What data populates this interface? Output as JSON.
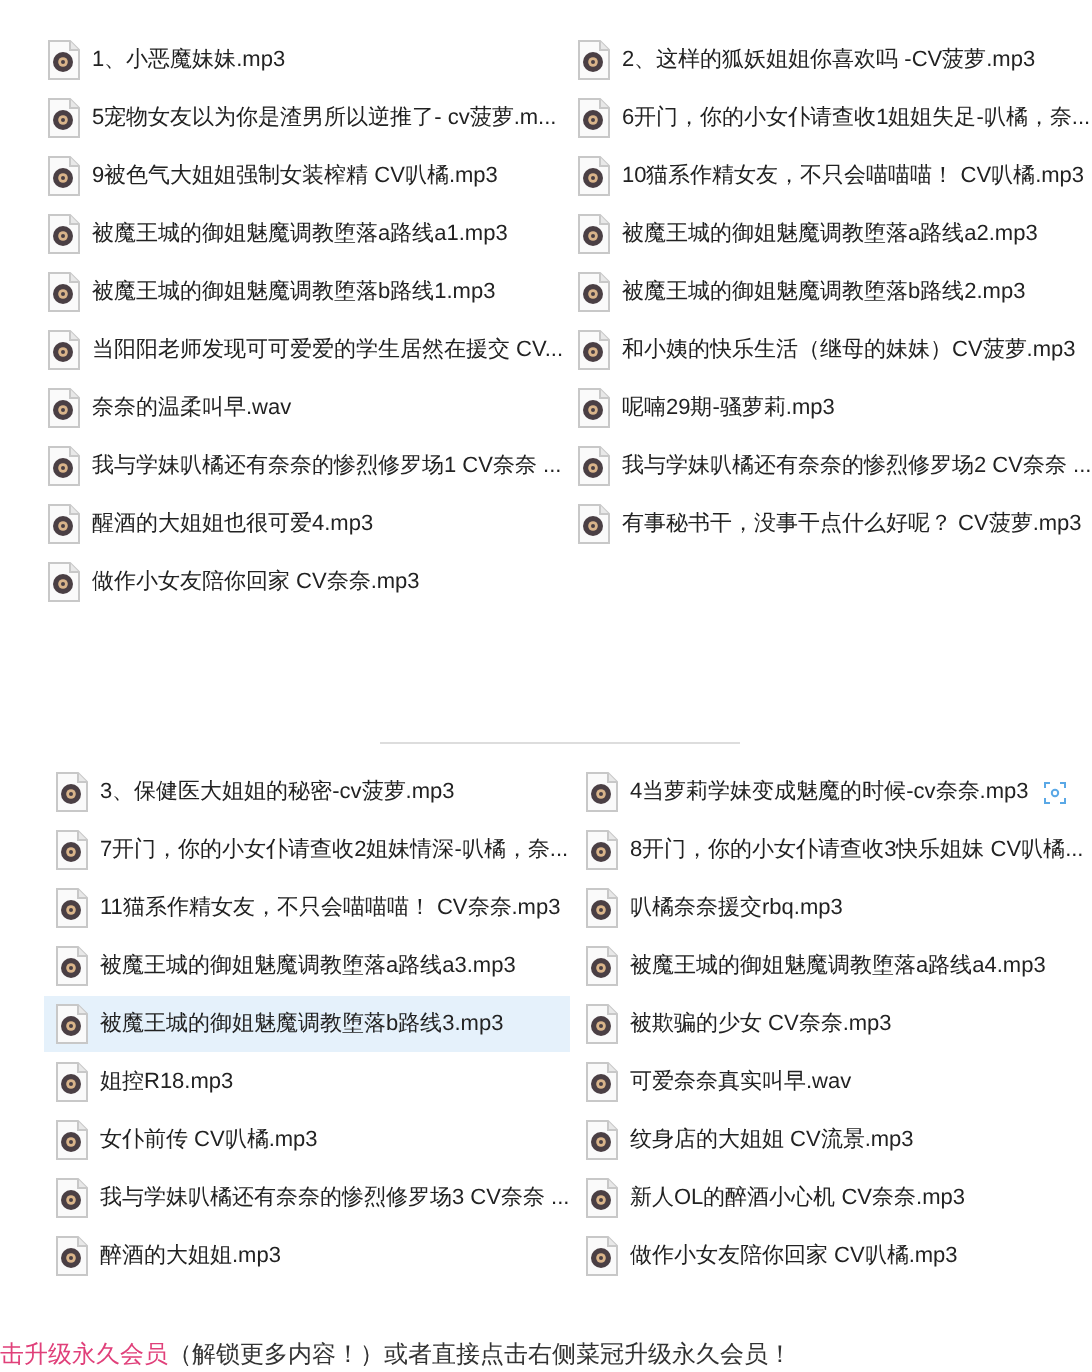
{
  "groups": [
    {
      "files": [
        {
          "name": "1、小恶魔妹妹.mp3",
          "selected": false
        },
        {
          "name": "2、这样的狐妖姐姐你喜欢吗 -CV菠萝.mp3",
          "selected": false
        },
        {
          "name": "5宠物女友以为你是渣男所以逆推了- cv菠萝.m...",
          "selected": false
        },
        {
          "name": "6开门，你的小女仆请查收1姐姐失足-叭橘，奈...",
          "selected": false
        },
        {
          "name": "9被色气大姐姐强制女装榨精 CV叭橘.mp3",
          "selected": false
        },
        {
          "name": "10猫系作精女友，不只会喵喵喵！ CV叭橘.mp3",
          "selected": false
        },
        {
          "name": "被魔王城的御姐魅魔调教堕落a路线a1.mp3",
          "selected": false
        },
        {
          "name": "被魔王城的御姐魅魔调教堕落a路线a2.mp3",
          "selected": false
        },
        {
          "name": "被魔王城的御姐魅魔调教堕落b路线1.mp3",
          "selected": false
        },
        {
          "name": "被魔王城的御姐魅魔调教堕落b路线2.mp3",
          "selected": false
        },
        {
          "name": "当阳阳老师发现可可爱爱的学生居然在援交 CV...",
          "selected": false
        },
        {
          "name": "和小姨的快乐生活（继母的妹妹）CV菠萝.mp3",
          "selected": false
        },
        {
          "name": "奈奈的温柔叫早.wav",
          "selected": false
        },
        {
          "name": "呢喃29期-骚萝莉.mp3",
          "selected": false
        },
        {
          "name": "我与学妹叭橘还有奈奈的惨烈修罗场1 CV奈奈 ...",
          "selected": false
        },
        {
          "name": "我与学妹叭橘还有奈奈的惨烈修罗场2 CV奈奈 ...",
          "selected": false
        },
        {
          "name": "醒酒的大姐姐也很可爱4.mp3",
          "selected": false
        },
        {
          "name": "有事秘书干，没事干点什么好呢？ CV菠萝.mp3",
          "selected": false
        },
        {
          "name": "做作小女友陪你回家 CV奈奈.mp3",
          "selected": false
        }
      ]
    },
    {
      "files": [
        {
          "name": "3、保健医大姐姐的秘密-cv菠萝.mp3",
          "selected": false
        },
        {
          "name": "4当萝莉学妹变成魅魔的时候-cv奈奈.mp3",
          "selected": false,
          "tag_icon": true
        },
        {
          "name": "7开门，你的小女仆请查收2姐妹情深-叭橘，奈...",
          "selected": false
        },
        {
          "name": "8开门，你的小女仆请查收3快乐姐妹 CV叭橘...",
          "selected": false
        },
        {
          "name": "11猫系作精女友，不只会喵喵喵！ CV奈奈.mp3",
          "selected": false
        },
        {
          "name": "叭橘奈奈援交rbq.mp3",
          "selected": false
        },
        {
          "name": "被魔王城的御姐魅魔调教堕落a路线a3.mp3",
          "selected": false
        },
        {
          "name": "被魔王城的御姐魅魔调教堕落a路线a4.mp3",
          "selected": false
        },
        {
          "name": "被魔王城的御姐魅魔调教堕落b路线3.mp3",
          "selected": true
        },
        {
          "name": "被欺骗的少女 CV奈奈.mp3",
          "selected": false
        },
        {
          "name": "姐控R18.mp3",
          "selected": false
        },
        {
          "name": "可爱奈奈真实叫早.wav",
          "selected": false
        },
        {
          "name": "女仆前传 CV叭橘.mp3",
          "selected": false
        },
        {
          "name": "纹身店的大姐姐 CV流景.mp3",
          "selected": false
        },
        {
          "name": "我与学妹叭橘还有奈奈的惨烈修罗场3 CV奈奈 ...",
          "selected": false
        },
        {
          "name": "新人OL的醉酒小心机 CV奈奈.mp3",
          "selected": false
        },
        {
          "name": "醉酒的大姐姐.mp3",
          "selected": false
        },
        {
          "name": "做作小女友陪你回家 CV叭橘.mp3",
          "selected": false
        }
      ]
    }
  ],
  "footer": {
    "link": "击升级永久会员",
    "text": "（解锁更多内容！）或者直接点击右侧菜冠升级永久会员！"
  }
}
